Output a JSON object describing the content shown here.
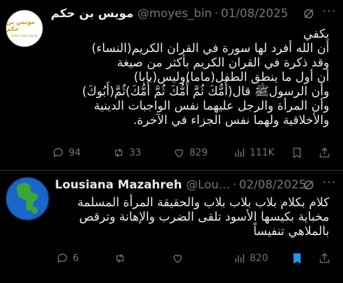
{
  "tweet1": {
    "display_name": "مويس بن حكم",
    "handle": "@moyes_bin",
    "separator": "·",
    "date": "01/08/2025",
    "avatar_text_ar": "مويس بن حكم",
    "avatar_text_en": "MOYES BIN HAKAM",
    "lines": [
      "يكفي",
      "أن الله أفرد لها سورة في القران الكريم(النساء)",
      "وقد ذكرة في القران الكريم بأكثر من صيغة",
      "أن أول ما ينطق الطفل(ماما)وليس(بابا)",
      "وأن الرسولﷺ قال(أُمُّكَ ثُمَّ أُمُّكَ ثُمَّ أُمُّكَ)ثُمَّ(أَبُوكَ)",
      "وأن المرأة والرجل عليهما نفس الواجبات الدينية",
      "والأخلاقية ولهما نفس الجزاء في الآخرة."
    ],
    "stats": {
      "replies": "94",
      "retweets": "33",
      "likes": "829",
      "views": "111K"
    }
  },
  "tweet2": {
    "display_name": "Lousiana Mazahreh",
    "handle": "@Lou...",
    "separator": "·",
    "date": "02/08/2025",
    "lines": [
      "كلام بكلام بلاب بلاب بلاب والحقيقة المرأة المسلمة",
      "مخباية بكيسها الأسود تلقى الضرب والإهانة وترقص",
      "بالملاهي تنفيساً"
    ],
    "stats": {
      "replies": "6",
      "retweets": "",
      "likes": "",
      "views": "820"
    }
  },
  "colors": {
    "background": "#000000",
    "text": "#e7e9ea",
    "muted": "#71767b",
    "divider": "#2f3336",
    "bookmark_active": "#1d9bf0"
  }
}
